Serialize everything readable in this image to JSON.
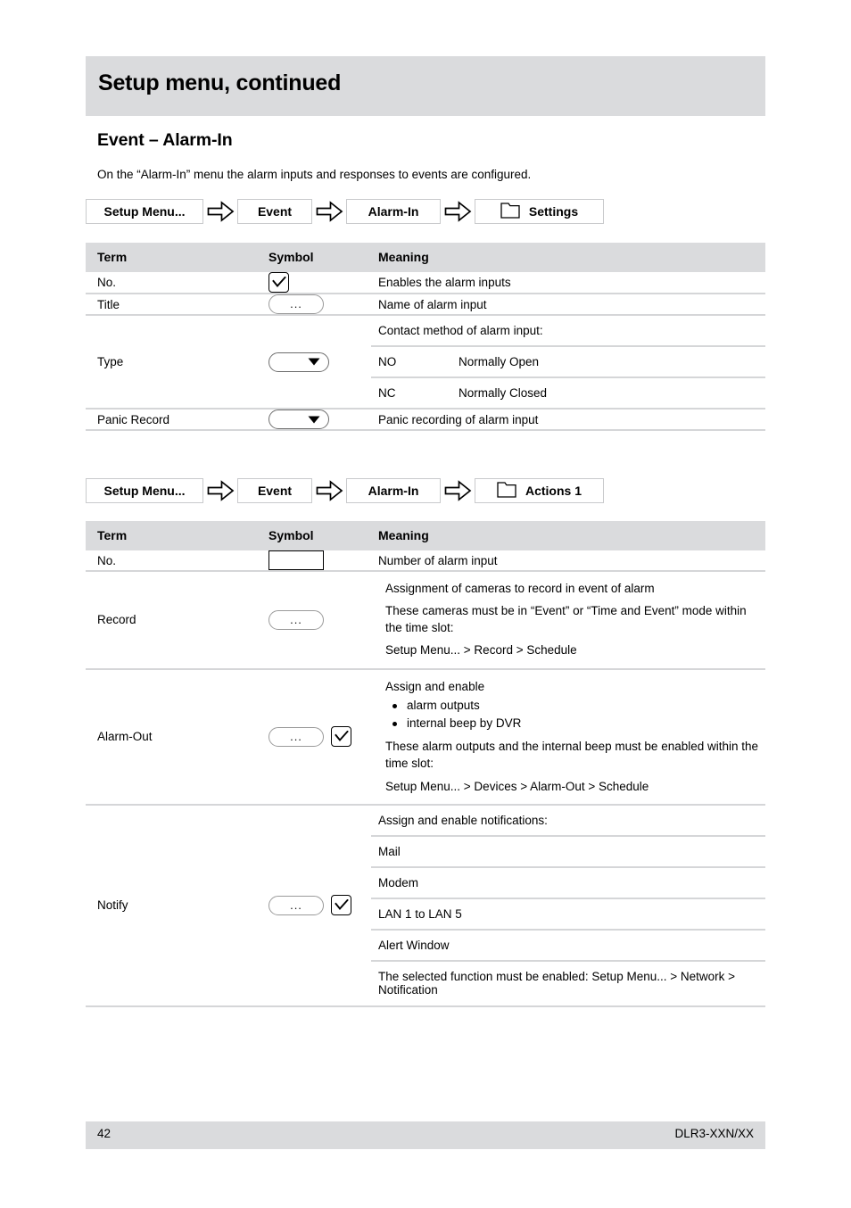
{
  "header": {
    "title": "Setup menu, continued"
  },
  "section": {
    "heading": "Event – Alarm-In",
    "intro": "On the “Alarm-In” menu the alarm inputs and responses to events are configured."
  },
  "breadcrumb1": {
    "items": [
      "Setup Menu...",
      "Event",
      "Alarm-In",
      "Settings"
    ],
    "arrow_icon": "arrow-right-outline-icon",
    "folder_icon": "folder-icon"
  },
  "breadcrumb2": {
    "items": [
      "Setup Menu...",
      "Event",
      "Alarm-In",
      "Actions 1"
    ],
    "arrow_icon": "arrow-right-outline-icon",
    "folder_icon": "folder-icon"
  },
  "table1": {
    "columns": [
      "Term",
      "Symbol",
      "Meaning"
    ],
    "rows": [
      {
        "term": "No.",
        "symbol": [
          "checkbox-checked-icon"
        ],
        "meaning": "Enables the alarm inputs"
      },
      {
        "term": "Title",
        "symbol": [
          "ellipsis-button-icon"
        ],
        "symbol_label": "...",
        "meaning": "Name of alarm input"
      },
      {
        "term": "Type",
        "symbol": [
          "dropdown-icon"
        ],
        "meaning_sub": [
          {
            "c1": "Contact method of alarm input:",
            "c2": "",
            "span": true
          },
          {
            "c1": "NO",
            "c2": "Normally Open",
            "span": false
          },
          {
            "c1": "NC",
            "c2": "Normally Closed",
            "span": false
          }
        ]
      },
      {
        "term": "Panic Record",
        "symbol": [
          "dropdown-icon"
        ],
        "meaning": "Panic recording of alarm input"
      }
    ]
  },
  "table2": {
    "columns": [
      "Term",
      "Symbol",
      "Meaning"
    ],
    "rows": [
      {
        "term": "No.",
        "symbol": [
          "input-box-icon"
        ],
        "meaning": "Number of alarm input"
      },
      {
        "term": "Record",
        "symbol": [
          "ellipsis-button-icon"
        ],
        "symbol_label": "...",
        "meaning_lines": [
          "Assignment of cameras to record in event of alarm",
          "These cameras must be in “Event” or “Time and Event” mode within the time slot:",
          "Setup Menu... > Record > Schedule"
        ]
      },
      {
        "term": "Alarm-Out",
        "symbol": [
          "ellipsis-button-icon",
          "checkbox-checked-icon"
        ],
        "symbol_label": "...",
        "meaning_intro": "Assign and enable",
        "meaning_bullets": [
          "alarm outputs",
          "internal beep by DVR"
        ],
        "meaning_tail": [
          "These alarm outputs and the internal beep must be enabled within the time slot:",
          "Setup Menu... > Devices > Alarm-Out > Schedule"
        ]
      },
      {
        "term": "Notify",
        "symbol": [
          "ellipsis-button-icon",
          "checkbox-checked-icon"
        ],
        "symbol_label": "...",
        "meaning_sub": [
          "Assign and enable notifications:",
          "Mail",
          "Modem",
          "LAN 1 to LAN 5",
          "Alert Window"
        ],
        "meaning_tail": [
          "The selected function must be enabled:",
          "Setup Menu... > Network > Notification"
        ]
      }
    ]
  },
  "footer": {
    "page_number": "42",
    "model": "DLR3-XXN/XX"
  }
}
